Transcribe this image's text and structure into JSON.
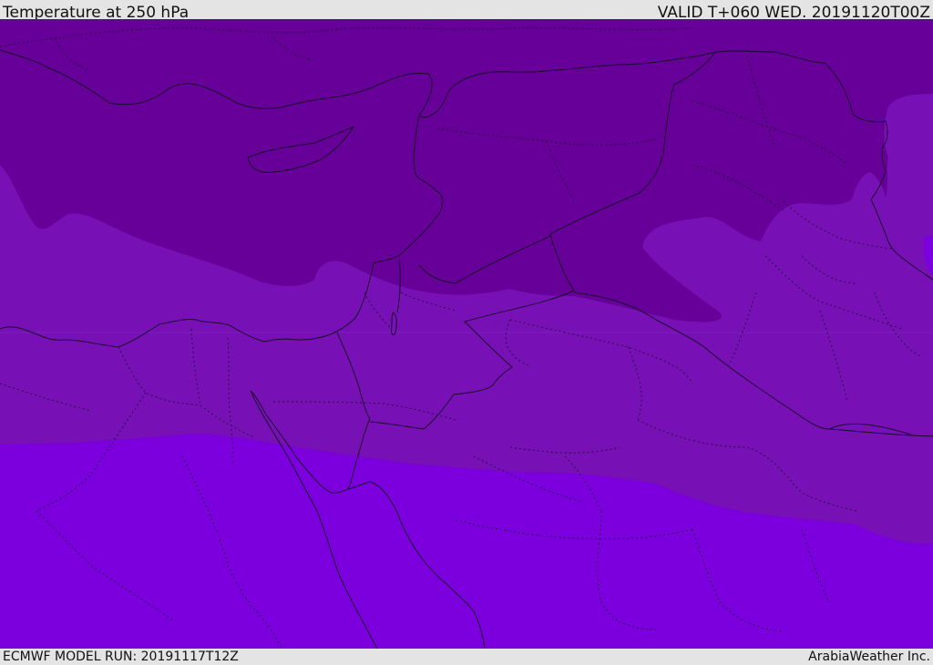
{
  "header": {
    "title": "Temperature at 250 hPa",
    "valid": "VALID T+060 WED. 20191120T00Z"
  },
  "footer": {
    "model_run": "ECMWF MODEL RUN: 20191117T12Z",
    "provider": "ArabiaWeather Inc."
  },
  "map": {
    "field": "temperature",
    "level": "250 hPa",
    "colors": {
      "coldest": "#660099",
      "middle": "#7711b5",
      "warmest": "#7b00dd",
      "border": "#1a0a2a",
      "admin_border": "#2a0a44"
    }
  }
}
